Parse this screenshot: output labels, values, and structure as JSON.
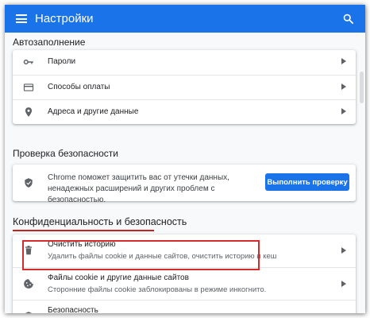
{
  "header": {
    "title": "Настройки"
  },
  "autofill": {
    "heading": "Автозаполнение",
    "items": [
      {
        "label": "Пароли"
      },
      {
        "label": "Способы оплаты"
      },
      {
        "label": "Адреса и другие данные"
      }
    ]
  },
  "safety": {
    "heading": "Проверка безопасности",
    "text": "Chrome поможет защитить вас от утечки данных, ненадежных расширений и других проблем с безопасностью.",
    "button": "Выполнить проверку"
  },
  "privacy": {
    "heading": "Конфиденциальность и безопасность",
    "items": [
      {
        "label": "Очистить историю",
        "sub": "Удалить файлы cookie и данные сайтов, очистить историю и кеш"
      },
      {
        "label": "Файлы cookie и другие данные сайтов",
        "sub": "Сторонние файлы cookie заблокированы в режиме инкогнито."
      },
      {
        "label": "Безопасность"
      }
    ]
  },
  "colors": {
    "accent": "#1a73e8",
    "annotation": "#d62b2b"
  }
}
